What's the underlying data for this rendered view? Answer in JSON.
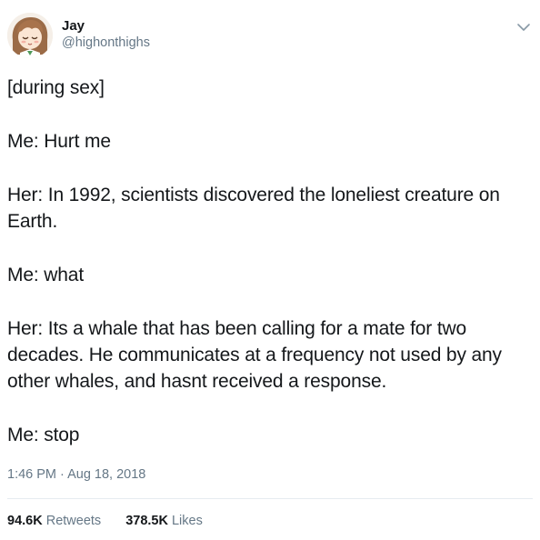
{
  "author": {
    "name": "Jay",
    "handle": "@highonthighs"
  },
  "tweet": {
    "paragraphs": [
      "[during sex]",
      "Me: Hurt me",
      "Her: In 1992, scientists discovered the loneliest creature on Earth.",
      "Me: what",
      "Her: Its a whale that has been calling for a mate for two decades. He communicates at a frequency not used by any other whales, and hasnt received a response.",
      "Me: stop"
    ],
    "timestamp": "1:46 PM · Aug 18, 2018"
  },
  "stats": {
    "retweets_count": "94.6K",
    "retweets_label": "Retweets",
    "likes_count": "378.5K",
    "likes_label": "Likes"
  },
  "icons": {
    "menu": "chevron-down-icon"
  },
  "colors": {
    "text": "#14171a",
    "secondary_text": "#657786",
    "divider": "#e6ecf0",
    "caret": "#8899a6"
  }
}
